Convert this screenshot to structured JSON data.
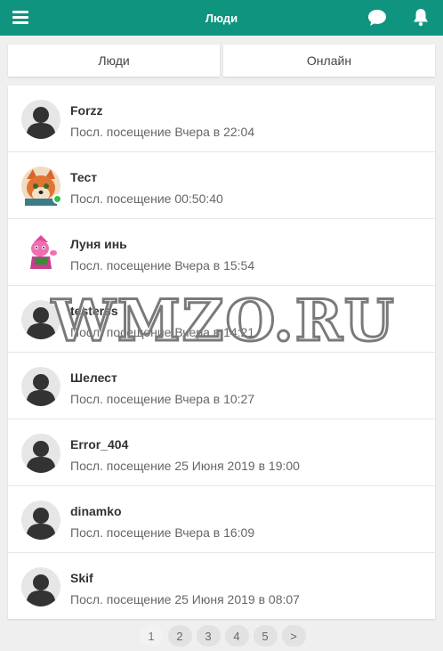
{
  "header": {
    "title": "Люди",
    "menu_icon": "hamburger-menu-icon",
    "chat_icon": "chat-bubble-icon",
    "bell_icon": "bell-icon",
    "color": "#0f9480"
  },
  "tabs": [
    {
      "label": "Люди"
    },
    {
      "label": "Онлайн"
    }
  ],
  "users": [
    {
      "name": "Forzz",
      "last_seen": "Посл. посещение Вчера в 22:04",
      "avatar": "default-avatar-icon",
      "online": false
    },
    {
      "name": "Тест",
      "last_seen": "Посл. посещение 00:50:40",
      "avatar": "fox-avatar",
      "online": true
    },
    {
      "name": "Луня инь",
      "last_seen": "Посл. посещение Вчера в 15:54",
      "avatar": "pink-character-avatar",
      "online": false
    },
    {
      "name": "testerss",
      "last_seen": "Посл. посещение Вчера в 14:21",
      "avatar": "default-avatar-icon",
      "online": false
    },
    {
      "name": "Шелест",
      "last_seen": "Посл. посещение Вчера в 10:27",
      "avatar": "default-avatar-icon",
      "online": false
    },
    {
      "name": "Error_404",
      "last_seen": "Посл. посещение 25 Июня 2019 в 19:00",
      "avatar": "default-avatar-icon",
      "online": false
    },
    {
      "name": "dinamko",
      "last_seen": "Посл. посещение Вчера в 16:09",
      "avatar": "default-avatar-icon",
      "online": false
    },
    {
      "name": "Skif",
      "last_seen": "Посл. посещение 25 Июня 2019 в 08:07",
      "avatar": "default-avatar-icon",
      "online": false
    }
  ],
  "pagination": {
    "pages": [
      "1",
      "2",
      "3",
      "4",
      "5"
    ],
    "current": "1",
    "next_label": ">"
  },
  "watermark": "WMZO.RU",
  "colors": {
    "online": "#2ec24a",
    "avatar_bg": "#e6e6e6",
    "avatar_fg": "#333333"
  }
}
